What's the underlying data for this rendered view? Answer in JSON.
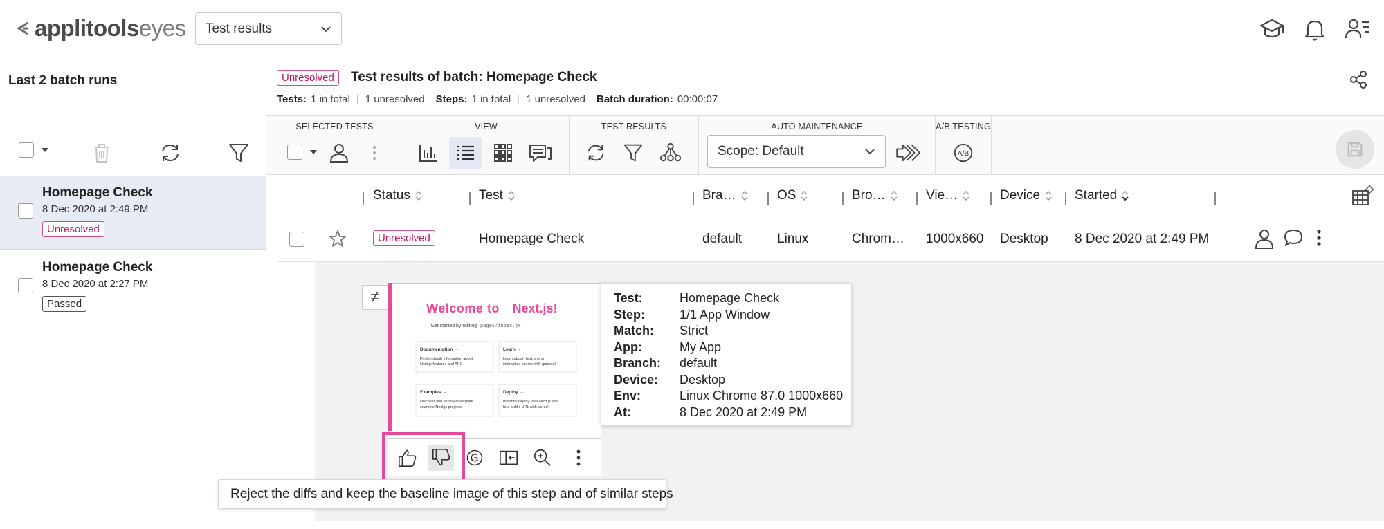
{
  "app": {
    "logo_bold": "applitools",
    "logo_light": "eyes",
    "page_select": "Test results",
    "colors": {
      "accent": "#e64a98",
      "unresolved": "#c2185b",
      "active_view": "#e3e8f2"
    }
  },
  "top_icons": [
    "tutorials-icon",
    "bell-icon",
    "user-menu-icon"
  ],
  "left_panel": {
    "title": "Last 2 batch runs",
    "batches": [
      {
        "name": "Homepage Check",
        "date": "8 Dec 2020 at 2:49 PM",
        "status": "Unresolved",
        "selected": true
      },
      {
        "name": "Homepage Check",
        "date": "8 Dec 2020 at 2:27 PM",
        "status": "Passed",
        "selected": false
      }
    ]
  },
  "header": {
    "status": "Unresolved",
    "title": "Test results of batch:  Homepage Check",
    "tests_label": "Tests:",
    "tests_total": "1 in total",
    "tests_unresolved": "1 unresolved",
    "steps_label": "Steps:",
    "steps_total": "1 in total",
    "steps_unresolved": "1 unresolved",
    "duration_label": "Batch duration:",
    "duration_value": "00:00:07"
  },
  "toolbar": {
    "groups": {
      "selected_tests": "SELECTED TESTS",
      "view": "VIEW",
      "test_results": "TEST RESULTS",
      "auto_maintenance": "AUTO MAINTENANCE",
      "ab_testing": "A/B TESTING"
    },
    "scope": "Scope: Default"
  },
  "table": {
    "headers": {
      "status": "Status",
      "test": "Test",
      "branch": "Bra…",
      "os": "OS",
      "browser": "Bro…",
      "viewport": "Vie…",
      "device": "Device",
      "started": "Started"
    },
    "row": {
      "status": "Unresolved",
      "test": "Homepage Check",
      "branch": "default",
      "os": "Linux",
      "browser": "Chrom…",
      "viewport": "1000x660",
      "device": "Desktop",
      "started": "8 Dec 2020 at 2:49 PM"
    }
  },
  "step": {
    "neq_symbol": "≠",
    "thumbnail": {
      "welcome": "Welcome to",
      "brand": "Next.js!",
      "subtitle": "Get started by editing",
      "code": "pages/index.js",
      "cards": [
        {
          "title": "Documentation →",
          "line1": "Find in-depth information about",
          "line2": "Next.js features and API."
        },
        {
          "title": "Learn →",
          "line1": "Learn about Next.js in an",
          "line2": "interactive course with quizzes!"
        },
        {
          "title": "Examples →",
          "line1": "Discover and deploy boilerplate",
          "line2": "example Next.js projects."
        },
        {
          "title": "Deploy →",
          "line1": "Instantly deploy your Next.js site",
          "line2": "to a public URL with Vercel."
        }
      ]
    },
    "info": {
      "test_label": "Test:",
      "test": "Homepage Check",
      "step_label": "Step:",
      "step": "1/1 App Window",
      "match_label": "Match:",
      "match": "Strict",
      "app_label": "App:",
      "app": "My App",
      "branch_label": "Branch:",
      "branch": "default",
      "device_label": "Device:",
      "device": "Desktop",
      "env_label": "Env:",
      "env": "Linux Chrome 87.0 1000x660",
      "at_label": "At:",
      "at": "8 Dec 2020 at 2:49 PM"
    },
    "tooltip": "Reject the diffs and keep the baseline image of this step and of similar steps"
  }
}
